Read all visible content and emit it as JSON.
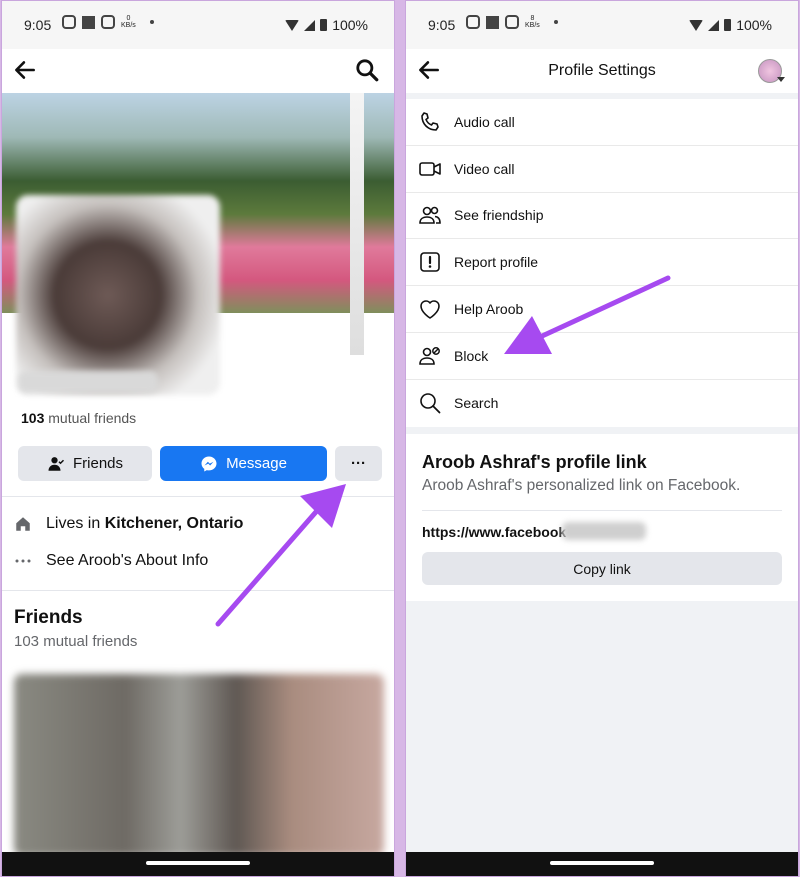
{
  "left": {
    "status": {
      "time": "9:05",
      "kbs": "0",
      "kbs_unit": "KB/s",
      "battery": "100%"
    },
    "profile": {
      "mutual_count": "103",
      "mutual_label": "mutual friends"
    },
    "buttons": {
      "friends": "Friends",
      "message": "Message",
      "more": "···"
    },
    "info": {
      "lives_prefix": "Lives in",
      "lives_place": "Kitchener, Ontario",
      "about": "See Aroob's About Info"
    },
    "friends_section": {
      "title": "Friends",
      "subtitle": "103 mutual friends"
    }
  },
  "right": {
    "status": {
      "time": "9:05",
      "kbs": "8",
      "kbs_unit": "KB/s",
      "battery": "100%"
    },
    "title": "Profile Settings",
    "items": [
      {
        "label": "Audio call",
        "icon": "phone-icon"
      },
      {
        "label": "Video call",
        "icon": "video-icon"
      },
      {
        "label": "See friendship",
        "icon": "friendship-icon"
      },
      {
        "label": "Report profile",
        "icon": "report-icon"
      },
      {
        "label": "Help Aroob",
        "icon": "heart-icon"
      },
      {
        "label": "Block",
        "icon": "block-user-icon"
      },
      {
        "label": "Search",
        "icon": "search-icon"
      }
    ],
    "link_card": {
      "title": "Aroob Ashraf's profile link",
      "subtitle": "Aroob Ashraf's personalized link on Facebook.",
      "url": "https://www.facebook",
      "copy": "Copy link"
    }
  },
  "colors": {
    "accent": "#1877f2",
    "arrow": "#a64af0"
  }
}
